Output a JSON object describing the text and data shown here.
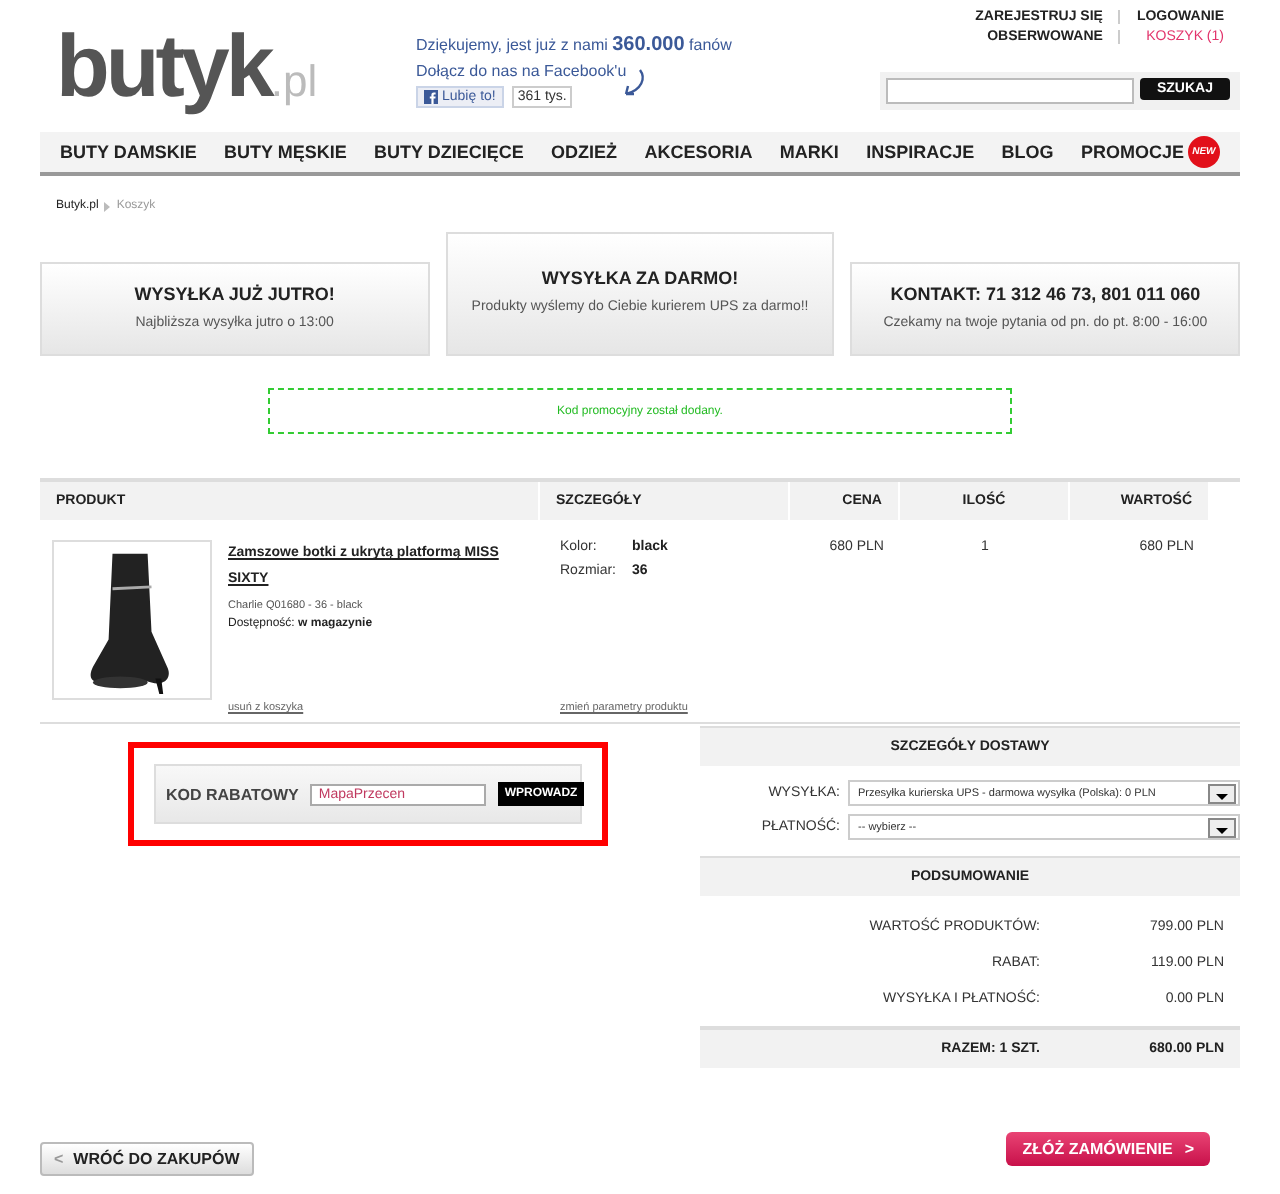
{
  "logo": {
    "name": "butyk",
    "suffix": ".pl"
  },
  "facebook": {
    "line1_pre": "Dziękujemy, jest już z nami",
    "count": "360.000",
    "line1_post": "fanów",
    "line2": "Dołącz do nas na Facebook'u",
    "like": "Lubię to!",
    "likes": "361 tys."
  },
  "top_links": [
    {
      "label": "ZAREJESTRUJ SIĘ",
      "highlight": false
    },
    {
      "label": "LOGOWANIE",
      "highlight": false
    },
    {
      "label": "OBSERWOWANE",
      "highlight": false
    },
    {
      "label": "KOSZYK (1)",
      "highlight": true
    }
  ],
  "search": {
    "button": "SZUKAJ"
  },
  "nav": [
    {
      "label": "BUTY DAMSKIE"
    },
    {
      "label": "BUTY MĘSKIE"
    },
    {
      "label": "BUTY DZIECIĘCE"
    },
    {
      "label": "ODZIEŻ"
    },
    {
      "label": "AKCESORIA"
    },
    {
      "label": "MARKI"
    },
    {
      "label": "INSPIRACJE"
    },
    {
      "label": "BLOG"
    },
    {
      "label": "PROMOCJE",
      "badge": "NEW"
    }
  ],
  "breadcrumb": [
    "Butyk.pl",
    "Koszyk"
  ],
  "info_boxes": [
    {
      "title": "WYSYŁKA JUŻ JUTRO!",
      "text": "Najbliższa wysyłka jutro o 13:00",
      "raised": false
    },
    {
      "title": "WYSYŁKA ZA DARMO!",
      "text": "Produkty wyślemy do Ciebie kurierem UPS za darmo!!",
      "raised": true
    },
    {
      "title": "KONTAKT: 71 312 46 73, 801 011 060",
      "text": "Czekamy na twoje pytania od pn. do pt. 8:00 - 16:00",
      "raised": false
    }
  ],
  "promo_message": "Kod promocyjny został dodany.",
  "cart": {
    "columns": [
      "PRODUKT",
      "SZCZEGÓŁY",
      "CENA",
      "ILOŚĆ",
      "WARTOŚĆ"
    ],
    "rows": [
      {
        "kind": "picture",
        "name": "Zamszowe botki z ukrytą platformą MISS SIXTY",
        "variant": "Charlie Q01680 - 36 - black",
        "availability_label": "Dostępność:",
        "availability": "w magazynie",
        "remove": "usuń z koszyka",
        "details": [
          {
            "label": "Kolor:",
            "value": "black"
          },
          {
            "label": "Rozmiar:",
            "value": "36"
          }
        ],
        "change": "zmień parametry produktu",
        "price": "680 PLN",
        "quantity": "1",
        "total": "680 PLN"
      }
    ]
  },
  "discount": {
    "label": "KOD RABATOWY",
    "value": "MapaPrzecen",
    "button": "WPROWADZ"
  },
  "delivery": {
    "title": "SZCZEGÓŁY DOSTAWY",
    "fields": [
      {
        "label": "WYSYŁKA:",
        "value": "Przesyłka kurierska UPS - darmowa wysyłka (Polska): 0 PLN"
      },
      {
        "label": "PŁATNOŚĆ:",
        "value": "-- wybierz --"
      }
    ]
  },
  "summary": {
    "title": "PODSUMOWANIE",
    "rows": [
      {
        "label": "WARTOŚĆ PRODUKTÓW:",
        "value": "799.00 PLN"
      },
      {
        "label": "RABAT:",
        "value": "119.00 PLN"
      },
      {
        "label": "WYSYŁKA I PŁATNOŚĆ:",
        "value": "0.00 PLN"
      }
    ],
    "total_label": "RAZEM: 1 SZT.",
    "total_value": "680.00 PLN"
  },
  "back_button": {
    "arrow": "<",
    "label": "WRÓĆ DO ZAKUPÓW"
  },
  "order_button": {
    "label": "ZŁÓŻ ZAMÓWIENIE",
    "arrow": ">"
  }
}
